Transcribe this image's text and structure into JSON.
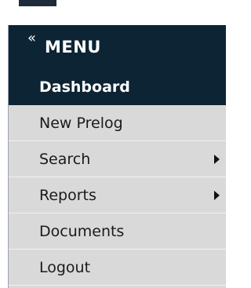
{
  "menu": {
    "collapse_icon": "«",
    "title": "MENU",
    "items": [
      {
        "label": "Dashboard",
        "active": true,
        "has_submenu": false
      },
      {
        "label": "New Prelog",
        "active": false,
        "has_submenu": false
      },
      {
        "label": "Search",
        "active": false,
        "has_submenu": true
      },
      {
        "label": "Reports",
        "active": false,
        "has_submenu": true
      },
      {
        "label": "Documents",
        "active": false,
        "has_submenu": false
      },
      {
        "label": "Logout",
        "active": false,
        "has_submenu": false
      }
    ]
  },
  "colors": {
    "header_bg": "#0c2433",
    "item_bg": "#d9d9d9",
    "active_text": "#ffffff",
    "item_text": "#1a1a1a"
  }
}
